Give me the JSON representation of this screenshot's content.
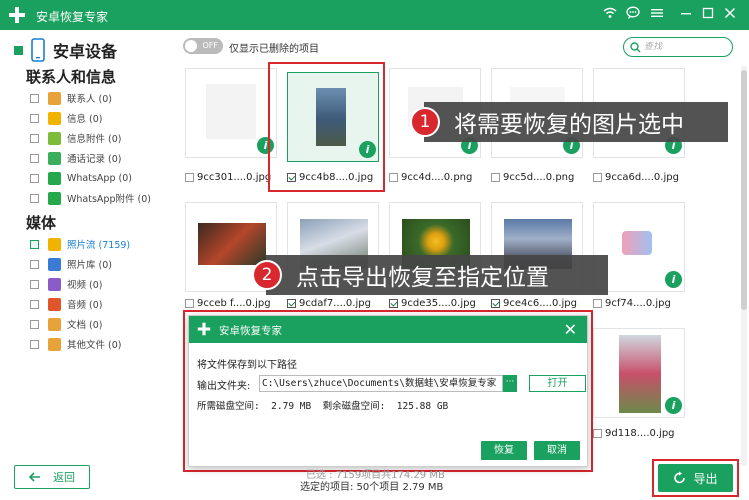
{
  "window": {
    "title": "安卓恢复专家"
  },
  "sidebar": {
    "device_label": "安卓设备",
    "contacts_section": "联系人和信息",
    "contacts_items": [
      {
        "label": "联系人 (0)",
        "icon": "contacts-icon",
        "color": "#e8a23a"
      },
      {
        "label": "信息 (0)",
        "icon": "message-icon",
        "color": "#f0b400"
      },
      {
        "label": "信息附件 (0)",
        "icon": "message-attachment-icon",
        "color": "#7cbc3a"
      },
      {
        "label": "通话记录 (0)",
        "icon": "call-log-icon",
        "color": "#3aae5a"
      },
      {
        "label": "WhatsApp (0)",
        "icon": "whatsapp-icon",
        "color": "#25a84a"
      },
      {
        "label": "WhatsApp附件 (0)",
        "icon": "whatsapp-attachment-icon",
        "color": "#25a84a"
      }
    ],
    "media_section": "媒体",
    "media_items": [
      {
        "label": "照片流 (7159)",
        "icon": "photo-stream-icon",
        "color": "#f0b400"
      },
      {
        "label": "照片库 (0)",
        "icon": "photo-library-icon",
        "color": "#3a7bd5"
      },
      {
        "label": "视频 (0)",
        "icon": "video-icon",
        "color": "#8b5bc7"
      },
      {
        "label": "音频 (0)",
        "icon": "audio-icon",
        "color": "#e0552a"
      },
      {
        "label": "文档 (0)",
        "icon": "document-icon",
        "color": "#e8a23a"
      },
      {
        "label": "其他文件 (0)",
        "icon": "other-files-icon",
        "color": "#e8a23a"
      }
    ],
    "back_label": "返回"
  },
  "toolbar": {
    "toggle_text": "OFF",
    "toggle_label": "仅显示已删除的项目",
    "search_placeholder": "查找"
  },
  "grid": {
    "row1": [
      "9cc301....0.jpg",
      "9cc4b8....0.jpg",
      "9cc4d....0.png",
      "9cc5d....0.png",
      "9cca6d....0.jpg"
    ],
    "row2": [
      "9cceb f....0.jpg",
      "9cdaf7....0.jpg",
      "9cde35....0.jpg",
      "9ce4c6....0.jpg",
      "9cf74....0.jpg"
    ],
    "row3_last": "9d118....0.jpg"
  },
  "callouts": [
    {
      "num": "1",
      "text": "将需要恢复的图片选中"
    },
    {
      "num": "2",
      "text": "点击导出恢复至指定位置"
    }
  ],
  "dialog": {
    "title": "安卓恢复专家",
    "prompt": "将文件保存到以下路径",
    "folder_label": "输出文件夹:",
    "folder_path": "C:\\Users\\zhuce\\Documents\\数据蛙\\安卓恢复专家",
    "browse_label": "···",
    "open_label": "打开",
    "space_line": "所需磁盘空间:  2.79 MB  剩余磁盘空间:  125.88 GB",
    "recover_label": "恢复",
    "cancel_label": "取消"
  },
  "status": {
    "hidden_line": "已选 : 7159项目共174.29 MB",
    "selected_line": "选定的项目: 50个项目 2.79 MB"
  },
  "export_label": "导出",
  "colors": {
    "accent": "#1aa15f",
    "highlight": "#d9272e"
  }
}
